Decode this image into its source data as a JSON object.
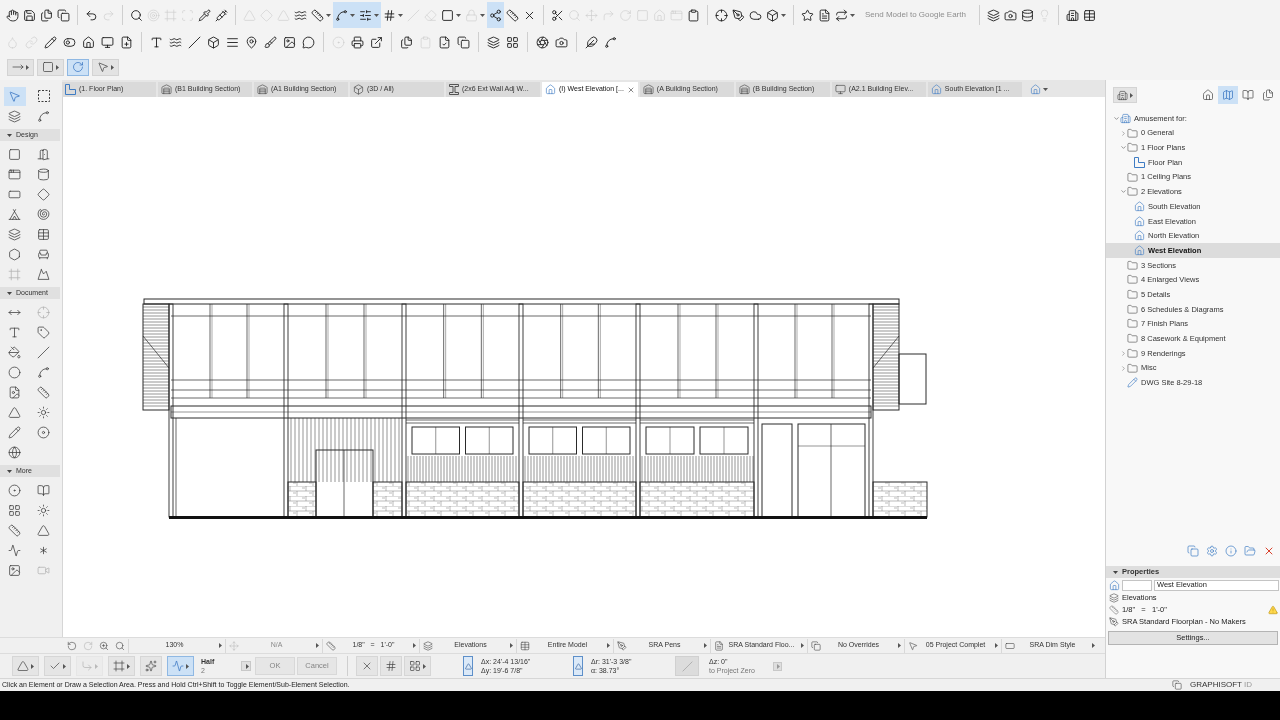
{
  "toolbars": [
    {
      "groups": [
        [
          {
            "kind": "icon",
            "on": false,
            "disabled": false,
            "menu": false
          },
          {
            "kind": "icon",
            "on": false,
            "disabled": false,
            "menu": false
          },
          {
            "kind": "icon",
            "on": false,
            "disabled": false,
            "menu": false
          },
          {
            "kind": "icon",
            "on": false,
            "disabled": false,
            "menu": false
          }
        ],
        [
          {
            "kind": "icon",
            "on": false,
            "disabled": false,
            "menu": false
          },
          {
            "kind": "icon",
            "on": false,
            "disabled": true,
            "menu": false
          }
        ],
        [
          {
            "kind": "icon",
            "on": false,
            "disabled": false,
            "menu": false
          },
          {
            "kind": "icon",
            "on": false,
            "disabled": true,
            "menu": false
          },
          {
            "kind": "icon",
            "on": false,
            "disabled": true,
            "menu": false
          },
          {
            "kind": "icon",
            "on": false,
            "disabled": true,
            "menu": false
          },
          {
            "kind": "icon",
            "on": false,
            "disabled": false,
            "menu": false
          },
          {
            "kind": "icon",
            "on": false,
            "disabled": false,
            "menu": false
          }
        ],
        [
          {
            "kind": "icon",
            "on": false,
            "disabled": true,
            "menu": false
          },
          {
            "kind": "icon",
            "on": false,
            "disabled": true,
            "menu": false
          },
          {
            "kind": "icon",
            "on": false,
            "disabled": true,
            "menu": false
          },
          {
            "kind": "icon",
            "on": false,
            "disabled": false,
            "menu": false
          },
          {
            "kind": "icon",
            "on": false,
            "disabled": false,
            "menu": true
          },
          {
            "kind": "icon",
            "on": true,
            "disabled": false,
            "menu": true
          },
          {
            "kind": "icon",
            "on": true,
            "disabled": false,
            "menu": true
          },
          {
            "kind": "icon",
            "on": false,
            "disabled": false,
            "menu": true
          },
          {
            "kind": "icon",
            "on": false,
            "disabled": true,
            "menu": false
          },
          {
            "kind": "icon",
            "on": false,
            "disabled": true,
            "menu": false
          },
          {
            "kind": "icon",
            "on": false,
            "disabled": false,
            "menu": true
          },
          {
            "kind": "icon",
            "on": false,
            "disabled": true,
            "menu": true
          },
          {
            "kind": "icon",
            "on": true,
            "disabled": false,
            "menu": false
          },
          {
            "kind": "icon",
            "on": false,
            "disabled": false,
            "menu": false
          },
          {
            "kind": "icon",
            "on": false,
            "disabled": false,
            "menu": false
          }
        ],
        [
          {
            "kind": "icon",
            "on": false,
            "disabled": false,
            "menu": false
          },
          {
            "kind": "icon",
            "on": false,
            "disabled": true,
            "menu": false
          },
          {
            "kind": "icon",
            "on": false,
            "disabled": true,
            "menu": false
          },
          {
            "kind": "icon",
            "on": false,
            "disabled": true,
            "menu": false
          },
          {
            "kind": "icon",
            "on": false,
            "disabled": true,
            "menu": false
          },
          {
            "kind": "icon",
            "on": false,
            "disabled": true,
            "menu": false
          },
          {
            "kind": "icon",
            "on": false,
            "disabled": true,
            "menu": false
          },
          {
            "kind": "icon",
            "on": false,
            "disabled": true,
            "menu": false
          },
          {
            "kind": "icon",
            "on": false,
            "disabled": false,
            "menu": false
          }
        ],
        [
          {
            "kind": "icon",
            "on": false,
            "disabled": false,
            "menu": false
          },
          {
            "kind": "icon",
            "on": false,
            "disabled": false,
            "menu": false
          },
          {
            "kind": "icon",
            "on": false,
            "disabled": false,
            "menu": false
          },
          {
            "kind": "icon",
            "on": false,
            "disabled": false,
            "menu": true
          }
        ],
        [
          {
            "kind": "icon",
            "on": false,
            "disabled": false,
            "menu": false
          },
          {
            "kind": "icon",
            "on": false,
            "disabled": false,
            "menu": false
          },
          {
            "kind": "icon",
            "on": false,
            "disabled": false,
            "menu": true
          },
          {
            "kind": "text",
            "label": "Send Model to Google Earth",
            "on": false,
            "disabled": true,
            "menu": false
          }
        ],
        [
          {
            "kind": "icon",
            "on": false,
            "disabled": false,
            "menu": false
          },
          {
            "kind": "icon",
            "on": false,
            "disabled": false,
            "menu": false
          },
          {
            "kind": "icon",
            "on": false,
            "disabled": false,
            "menu": false
          },
          {
            "kind": "icon",
            "on": false,
            "disabled": true,
            "menu": false
          }
        ],
        [
          {
            "kind": "icon",
            "on": false,
            "disabled": false,
            "menu": false
          },
          {
            "kind": "icon",
            "on": false,
            "disabled": false,
            "menu": false
          }
        ]
      ]
    },
    {
      "groups": [
        [
          {
            "kind": "icon",
            "on": false,
            "disabled": true,
            "menu": false
          },
          {
            "kind": "icon",
            "on": false,
            "disabled": true,
            "menu": false
          },
          {
            "kind": "icon",
            "on": false,
            "disabled": false,
            "menu": false
          },
          {
            "kind": "icon",
            "on": false,
            "disabled": false,
            "menu": false
          },
          {
            "kind": "icon",
            "on": false,
            "disabled": false,
            "menu": false
          },
          {
            "kind": "icon",
            "on": false,
            "disabled": false,
            "menu": false
          },
          {
            "kind": "icon",
            "on": false,
            "disabled": false,
            "menu": false
          }
        ],
        [
          {
            "kind": "icon",
            "on": false,
            "disabled": false,
            "menu": false
          },
          {
            "kind": "icon",
            "on": false,
            "disabled": false,
            "menu": false
          },
          {
            "kind": "icon",
            "on": false,
            "disabled": false,
            "menu": false
          },
          {
            "kind": "icon",
            "on": false,
            "disabled": false,
            "menu": false
          },
          {
            "kind": "icon",
            "on": false,
            "disabled": false,
            "menu": false
          },
          {
            "kind": "icon",
            "on": false,
            "disabled": false,
            "menu": false
          },
          {
            "kind": "icon",
            "on": false,
            "disabled": false,
            "menu": false
          },
          {
            "kind": "icon",
            "on": false,
            "disabled": false,
            "menu": false
          },
          {
            "kind": "icon",
            "on": false,
            "disabled": false,
            "menu": false
          }
        ],
        [
          {
            "kind": "icon",
            "on": false,
            "disabled": true,
            "menu": false
          },
          {
            "kind": "icon",
            "on": false,
            "disabled": false,
            "menu": false
          },
          {
            "kind": "icon",
            "on": false,
            "disabled": false,
            "menu": false
          }
        ],
        [
          {
            "kind": "icon",
            "on": false,
            "disabled": false,
            "menu": false
          },
          {
            "kind": "icon",
            "on": false,
            "disabled": true,
            "menu": false
          },
          {
            "kind": "icon",
            "on": false,
            "disabled": false,
            "menu": false
          },
          {
            "kind": "icon",
            "on": false,
            "disabled": false,
            "menu": false
          }
        ],
        [
          {
            "kind": "icon",
            "on": false,
            "disabled": false,
            "menu": false
          },
          {
            "kind": "icon",
            "on": false,
            "disabled": false,
            "menu": false
          }
        ],
        [
          {
            "kind": "icon",
            "on": false,
            "disabled": false,
            "menu": false
          },
          {
            "kind": "icon",
            "on": false,
            "disabled": false,
            "menu": false
          }
        ],
        [
          {
            "kind": "icon",
            "on": false,
            "disabled": false,
            "menu": false
          },
          {
            "kind": "icon",
            "on": false,
            "disabled": false,
            "menu": false
          }
        ]
      ]
    }
  ],
  "tool_selectors": [
    {
      "on": false,
      "menu": true
    },
    {
      "on": false,
      "menu": true
    },
    {
      "on": true,
      "menu": false
    },
    {
      "on": false,
      "menu": true
    }
  ],
  "tabs": [
    {
      "label": "(1. Floor Plan)",
      "kind": "floor_plan",
      "selected": false
    },
    {
      "label": "(B1 Building Section)",
      "kind": "section",
      "selected": false
    },
    {
      "label": "(A1 Building Section)",
      "kind": "section",
      "selected": false
    },
    {
      "label": "(3D / All)",
      "kind": "model",
      "selected": false
    },
    {
      "label": "(2x6 Ext Wall Adj W...",
      "kind": "detail",
      "selected": false
    },
    {
      "label": "(I) West Elevation [...",
      "kind": "elevation",
      "selected": true
    },
    {
      "label": "(A Building Section)",
      "kind": "section",
      "selected": false
    },
    {
      "label": "(B Building Section)",
      "kind": "section",
      "selected": false
    },
    {
      "label": "(A2.1 Building Elev...",
      "kind": "worksheet",
      "selected": false
    },
    {
      "label": "South Elevation [1 ...",
      "kind": "elevation",
      "selected": false
    }
  ],
  "toolbox": {
    "top": [
      {
        "selected": true,
        "disabled": false
      },
      {
        "selected": false,
        "disabled": false
      },
      {
        "selected": false,
        "disabled": false
      },
      {
        "selected": false,
        "disabled": false
      }
    ],
    "groups": [
      {
        "title": "Design",
        "expanded": true,
        "tools": [
          {
            "selected": false,
            "disabled": false
          },
          {
            "selected": false,
            "disabled": false
          },
          {
            "selected": false,
            "disabled": false
          },
          {
            "selected": false,
            "disabled": false
          },
          {
            "selected": false,
            "disabled": false
          },
          {
            "selected": false,
            "disabled": false
          },
          {
            "selected": false,
            "disabled": false
          },
          {
            "selected": false,
            "disabled": false
          },
          {
            "selected": false,
            "disabled": false
          },
          {
            "selected": false,
            "disabled": false
          },
          {
            "selected": false,
            "disabled": false
          },
          {
            "selected": false,
            "disabled": false
          },
          {
            "selected": false,
            "disabled": true
          },
          {
            "selected": false,
            "disabled": false
          }
        ]
      },
      {
        "title": "Document",
        "expanded": true,
        "tools": [
          {
            "selected": false,
            "disabled": false
          },
          {
            "selected": false,
            "disabled": true
          },
          {
            "selected": false,
            "disabled": false
          },
          {
            "selected": false,
            "disabled": false
          },
          {
            "selected": false,
            "disabled": false
          },
          {
            "selected": false,
            "disabled": false
          },
          {
            "selected": false,
            "disabled": false
          },
          {
            "selected": false,
            "disabled": false
          },
          {
            "selected": false,
            "disabled": false
          },
          {
            "selected": false,
            "disabled": false
          },
          {
            "selected": false,
            "disabled": false
          },
          {
            "selected": false,
            "disabled": false
          },
          {
            "selected": false,
            "disabled": false
          },
          {
            "selected": false,
            "disabled": false
          },
          {
            "selected": false,
            "disabled": false
          }
        ]
      },
      {
        "title": "More",
        "expanded": true,
        "tools": [
          {
            "selected": false,
            "disabled": false
          },
          {
            "selected": false,
            "disabled": false
          },
          {
            "selected": false,
            "disabled": false
          },
          {
            "selected": false,
            "disabled": false
          },
          {
            "selected": false,
            "disabled": false
          },
          {
            "selected": false,
            "disabled": false
          },
          {
            "selected": false,
            "disabled": false
          },
          {
            "selected": false,
            "disabled": false
          },
          {
            "selected": false,
            "disabled": false
          },
          {
            "selected": false,
            "disabled": true
          }
        ]
      }
    ]
  },
  "navigator": {
    "modes": [
      {
        "selected": false
      },
      {
        "selected": true
      },
      {
        "selected": false
      },
      {
        "selected": false
      }
    ],
    "tree": [
      {
        "label": "Amusement for:",
        "kind": "project",
        "expanded": true,
        "selected": false,
        "children": [
          {
            "label": "0 General",
            "kind": "folder",
            "expanded": false,
            "selected": false
          },
          {
            "label": "1 Floor Plans",
            "kind": "folder",
            "expanded": true,
            "selected": false,
            "children": [
              {
                "label": "Floor Plan",
                "kind": "floor_plan",
                "selected": false
              }
            ]
          },
          {
            "label": "1 Ceiling Plans",
            "kind": "folder",
            "selected": false
          },
          {
            "label": "2 Elevations",
            "kind": "folder",
            "expanded": true,
            "selected": false,
            "children": [
              {
                "label": "South Elevation",
                "kind": "elevation",
                "selected": false
              },
              {
                "label": "East Elevation",
                "kind": "elevation",
                "selected": false
              },
              {
                "label": "North Elevation",
                "kind": "elevation",
                "selected": false
              },
              {
                "label": "West Elevation",
                "kind": "elevation",
                "selected": true
              }
            ]
          },
          {
            "label": "3 Sections",
            "kind": "folder",
            "selected": false
          },
          {
            "label": "4 Enlarged Views",
            "kind": "folder",
            "selected": false
          },
          {
            "label": "5 Details",
            "kind": "folder",
            "selected": false
          },
          {
            "label": "6 Schedules & Diagrams",
            "kind": "folder",
            "selected": false
          },
          {
            "label": "7 Finish Plans",
            "kind": "folder",
            "selected": false
          },
          {
            "label": "8 Casework & Equipment",
            "kind": "folder",
            "selected": false
          },
          {
            "label": "9 Renderings",
            "kind": "folder",
            "expanded": false,
            "selected": false
          },
          {
            "label": "Misc",
            "kind": "folder",
            "expanded": false,
            "selected": false
          },
          {
            "label": "DWG Site 8-29-18",
            "kind": "drawing",
            "selected": false
          }
        ]
      }
    ]
  },
  "properties": {
    "title": "Properties",
    "expanded": true,
    "name": "West Elevation",
    "layer": "Elevations",
    "scale": "1/8\"   =   1'-0\"",
    "scale_warning": true,
    "pen_set": "SRA Standard Floorplan - No Makers",
    "button": "Settings..."
  },
  "quick_options": {
    "zoom_buttons": [
      {
        "disabled": false
      },
      {
        "disabled": true
      },
      {
        "disabled": false
      },
      {
        "disabled": false
      }
    ],
    "items": [
      {
        "label": "130%",
        "disabled": false
      },
      {
        "label": "N/A",
        "disabled": true
      },
      {
        "label": "1/8\"   =   1'-0\"",
        "disabled": false
      },
      {
        "label": "Elevations",
        "disabled": false
      },
      {
        "label": "Entire Model",
        "disabled": false
      },
      {
        "label": "SRA Pens",
        "disabled": false
      },
      {
        "label": "SRA Standard Floo...",
        "disabled": false
      },
      {
        "label": "No Overrides",
        "disabled": false
      },
      {
        "label": "05 Project Complet",
        "disabled": false
      },
      {
        "label": "SRA Dim Style",
        "disabled": false
      }
    ]
  },
  "info_box": {
    "tools": [
      {
        "on": false,
        "disabled": false,
        "menu": true
      },
      {
        "on": false,
        "disabled": false,
        "menu": true
      },
      {
        "on": false,
        "disabled": true,
        "menu": true
      },
      {
        "on": false,
        "disabled": false,
        "menu": true
      },
      {
        "on": false,
        "disabled": false,
        "menu": false
      },
      {
        "on": true,
        "disabled": false,
        "menu": true
      }
    ],
    "snap": {
      "label": "Half",
      "value": "2"
    },
    "buttons": [
      {
        "label": "OK",
        "disabled": true
      },
      {
        "label": "Cancel",
        "disabled": true
      }
    ],
    "snap_tools": [
      {
        "menu": false
      },
      {
        "menu": false
      },
      {
        "menu": true
      }
    ],
    "coordinates": [
      {
        "on": true,
        "lines": [
          "Δx: 24'-4 13/16\"",
          "Δy: 19'-6 7/8\""
        ]
      },
      {
        "on": true,
        "lines": [
          "Δr: 31'-3 3/8\"",
          "α: 38.73°"
        ]
      }
    ],
    "elevation": {
      "value": "Δz: 0\"",
      "reference": "to Project Zero"
    }
  },
  "status_bar": {
    "message": "Click an Element or Draw a Selection Area. Press and Hold Ctrl+Shift to Toggle Element/Sub-Element Selection.",
    "brand": "GRAPHISOFT",
    "brand_suffix": "ID"
  }
}
